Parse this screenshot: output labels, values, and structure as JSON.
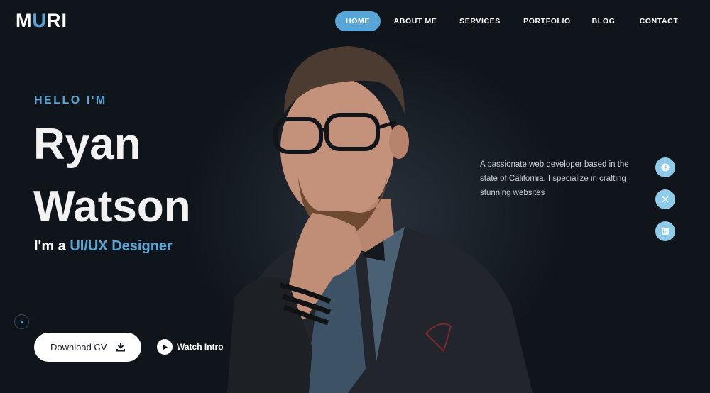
{
  "logo": {
    "prefix": "M",
    "accent": "U",
    "suffix": "RI"
  },
  "nav": [
    {
      "label": "HOME",
      "active": true
    },
    {
      "label": "ABOUT ME"
    },
    {
      "label": "SERVICES"
    },
    {
      "label": "PORTFOLIO"
    },
    {
      "label": "BLOG"
    },
    {
      "label": "CONTACT"
    }
  ],
  "hero": {
    "greeting": "HELLO I'M",
    "first_name": "Ryan",
    "last_name": "Watson",
    "role_prefix": "I'm a ",
    "role_highlight": "UI/UX Designer",
    "description": "A passionate web developer based in the state of California. I specialize in crafting stunning websites",
    "download_label": "Download CV",
    "watch_label": "Watch Intro"
  },
  "social": [
    {
      "icon": "facebook-icon"
    },
    {
      "icon": "x-twitter-icon"
    },
    {
      "icon": "linkedin-icon"
    }
  ],
  "colors": {
    "accent": "#58a6d8",
    "background": "#0f1419",
    "social_bg": "#8ecbe9"
  }
}
